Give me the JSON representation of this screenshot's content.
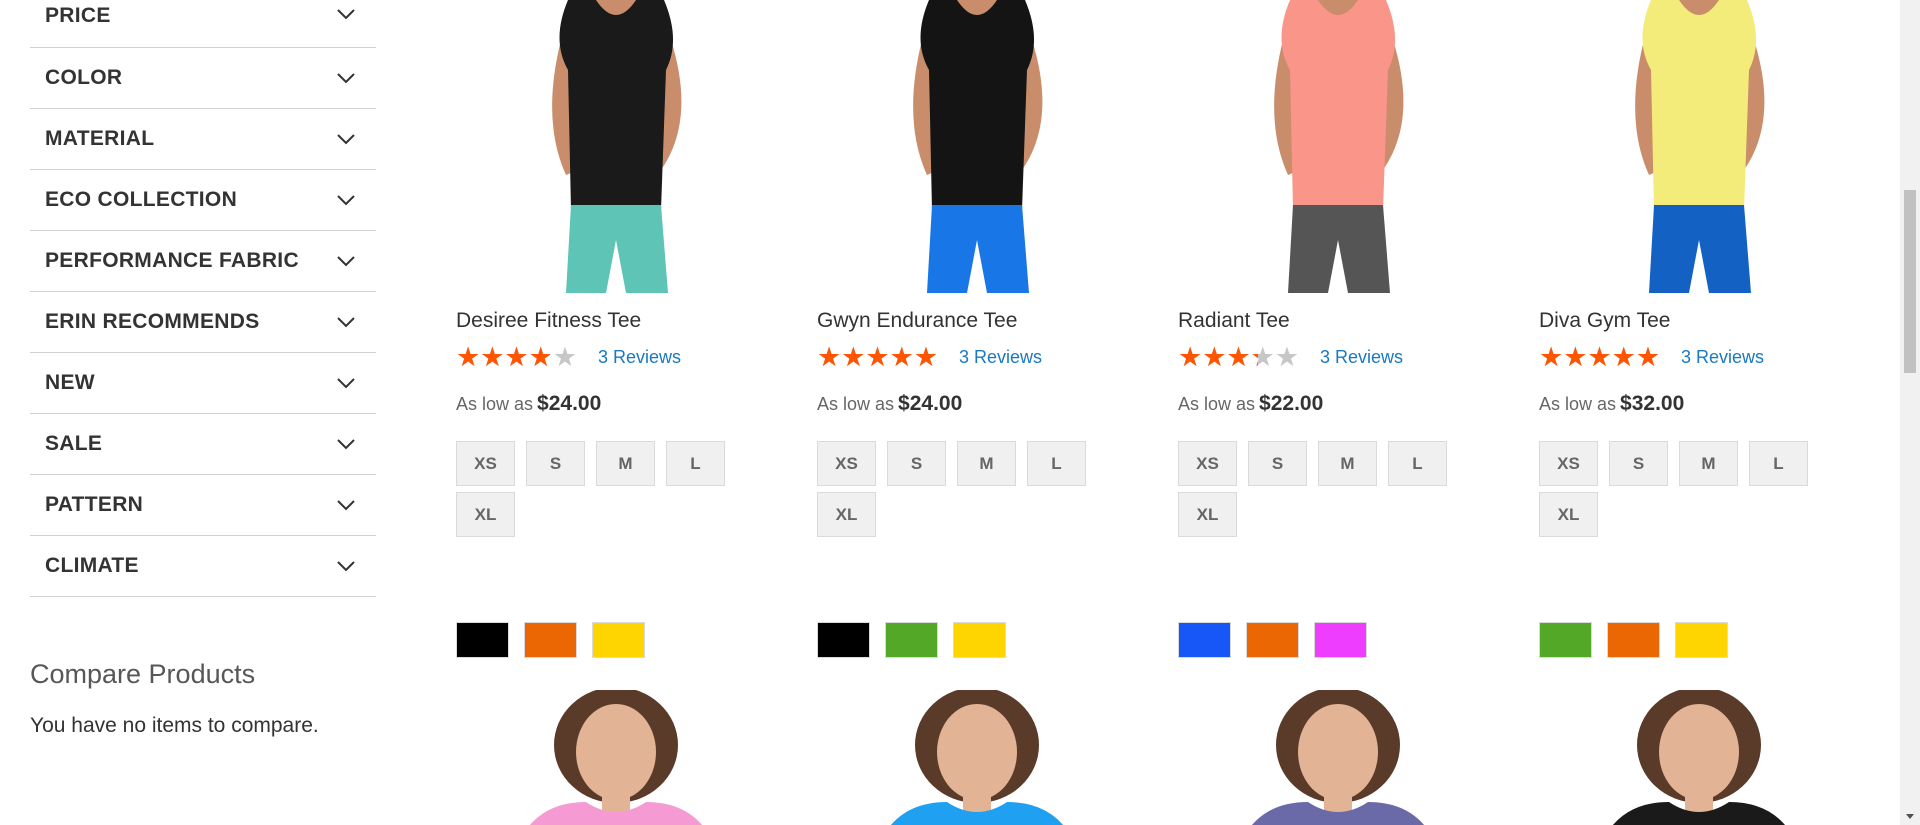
{
  "sidebar": {
    "filters": [
      {
        "label": "PRICE"
      },
      {
        "label": "COLOR"
      },
      {
        "label": "MATERIAL"
      },
      {
        "label": "ECO COLLECTION"
      },
      {
        "label": "PERFORMANCE FABRIC"
      },
      {
        "label": "ERIN RECOMMENDS"
      },
      {
        "label": "NEW"
      },
      {
        "label": "SALE"
      },
      {
        "label": "PATTERN"
      },
      {
        "label": "CLIMATE"
      }
    ],
    "compare": {
      "title": "Compare Products",
      "empty_text": "You have no items to compare."
    }
  },
  "products": [
    {
      "name": "Desiree Fitness Tee",
      "rating": 3.5,
      "reviews": "3 Reviews",
      "price_prefix": "As low as",
      "price": "$24.00",
      "sizes": [
        "XS",
        "S",
        "M",
        "L",
        "XL"
      ],
      "swatches": [
        "#000000",
        "#eb6703",
        "#ffd500"
      ],
      "photo": {
        "shirt": "#1a1a1a",
        "bottoms": "#5ec4b6"
      }
    },
    {
      "name": "Gwyn Endurance Tee",
      "rating": 4.5,
      "reviews": "3 Reviews",
      "price_prefix": "As low as",
      "price": "$24.00",
      "sizes": [
        "XS",
        "S",
        "M",
        "L",
        "XL"
      ],
      "swatches": [
        "#000000",
        "#53a828",
        "#ffd500"
      ],
      "photo": {
        "shirt": "#141414",
        "bottoms": "#1976e6"
      }
    },
    {
      "name": "Radiant Tee",
      "rating": 3,
      "reviews": "3 Reviews",
      "price_prefix": "As low as",
      "price": "$22.00",
      "sizes": [
        "XS",
        "S",
        "M",
        "L",
        "XL"
      ],
      "swatches": [
        "#1857f7",
        "#eb6703",
        "#ef3dff"
      ],
      "photo": {
        "shirt": "#fa958a",
        "bottoms": "#555555"
      }
    },
    {
      "name": "Diva Gym Tee",
      "rating": 4.5,
      "reviews": "3 Reviews",
      "price_prefix": "As low as",
      "price": "$32.00",
      "sizes": [
        "XS",
        "S",
        "M",
        "L",
        "XL"
      ],
      "swatches": [
        "#53a828",
        "#eb6703",
        "#ffd500"
      ],
      "photo": {
        "shirt": "#f4ec7a",
        "bottoms": "#1461c4"
      }
    }
  ],
  "next_row_shirts": [
    "#f59ad3",
    "#1fa0f0",
    "#6a6aa8",
    "#1a1a1a"
  ],
  "colors": {
    "star_filled": "#ff5501",
    "star_empty": "#c7c7c7",
    "link": "#1979c3"
  }
}
